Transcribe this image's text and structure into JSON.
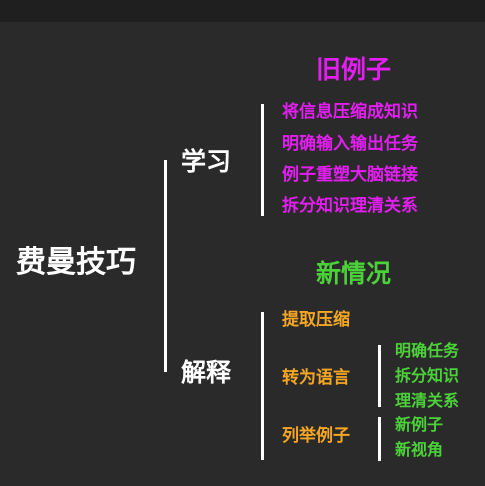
{
  "colors": {
    "background": "#2a2a2a",
    "magenta": "#e21ff0",
    "green": "#4cd13a",
    "orange": "#f5a623",
    "white": "#ffffff"
  },
  "root": {
    "label": "费曼技巧"
  },
  "study": {
    "label": "学习",
    "heading": "旧例子",
    "items": [
      "将信息压缩成知识",
      "明确输入输出任务",
      "例子重塑大脑链接",
      "拆分知识理清关系"
    ]
  },
  "explain": {
    "label": "解释",
    "heading": "新情况",
    "steps": [
      {
        "label": "提取压缩"
      },
      {
        "label": "转为语言",
        "details": [
          "明确任务",
          "拆分知识",
          "理清关系"
        ]
      },
      {
        "label": "列举例子",
        "details": [
          "新例子",
          "新视角"
        ]
      }
    ]
  }
}
